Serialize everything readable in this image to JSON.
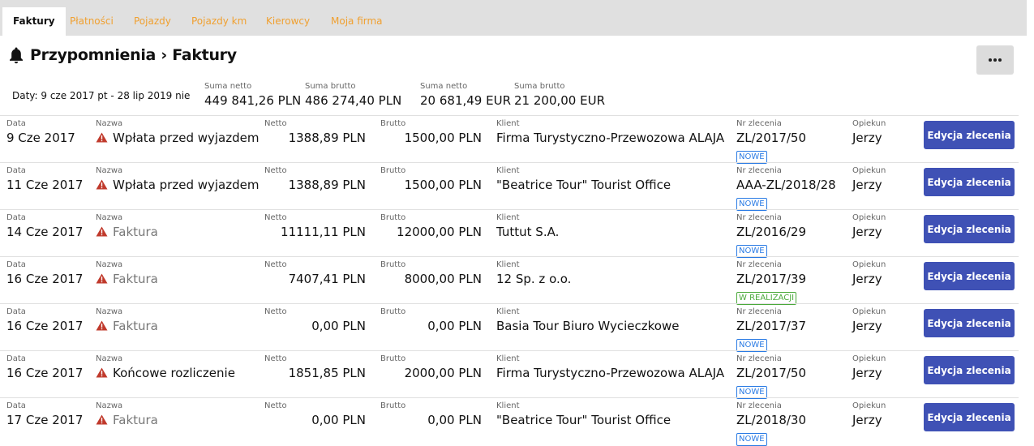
{
  "tabs": [
    "Faktury",
    "Płatności",
    "Pojazdy",
    "Pojazdy km",
    "Kierowcy",
    "Moja firma"
  ],
  "title": "Przypomnienia › Faktury",
  "summary": {
    "dates": "Daty: 9 cze 2017 pt - 28 lip 2019 nie",
    "items": [
      {
        "label": "Suma netto",
        "value": "449 841,26 PLN"
      },
      {
        "label": "Suma brutto",
        "value": "486 274,40 PLN"
      },
      {
        "label": "Suma netto",
        "value": "20 681,49 EUR"
      },
      {
        "label": "Suma brutto",
        "value": "21 200,00 EUR"
      }
    ]
  },
  "labels": {
    "data": "Data",
    "nazwa": "Nazwa",
    "netto": "Netto",
    "brutto": "Brutto",
    "klient": "Klient",
    "nr": "Nr zlecenia",
    "opiekun": "Opiekun"
  },
  "edit_label": "Edycja zlecenia",
  "colors": {
    "accent": "#3f51b5",
    "tab_inactive": "#f0a030",
    "warning": "#c0392b",
    "badge_new": "#2a7be4",
    "badge_in_progress": "#4aa93a"
  },
  "icons": {
    "bell": "bell-icon",
    "warning": "warning-icon",
    "more": "more-icon"
  },
  "rows": [
    {
      "data": "9 Cze 2017",
      "nazwa": "Wpłata przed wyjazdem",
      "muted": false,
      "netto": "1388,89 PLN",
      "brutto": "1500,00 PLN",
      "klient": "Firma Turystyczno-Przewozowa ALAJA",
      "nr": "ZL/2017/50",
      "status": "NOWE",
      "opiekun": "Jerzy"
    },
    {
      "data": "11 Cze 2017",
      "nazwa": "Wpłata przed wyjazdem",
      "muted": false,
      "netto": "1388,89 PLN",
      "brutto": "1500,00 PLN",
      "klient": "\"Beatrice Tour\" Tourist Office",
      "nr": "AAA-ZL/2018/28",
      "status": "NOWE",
      "opiekun": "Jerzy"
    },
    {
      "data": "14 Cze 2017",
      "nazwa": "Faktura",
      "muted": true,
      "netto": "11111,11 PLN",
      "brutto": "12000,00 PLN",
      "klient": "Tuttut S.A.",
      "nr": "ZL/2016/29",
      "status": "NOWE",
      "opiekun": "Jerzy"
    },
    {
      "data": "16 Cze 2017",
      "nazwa": "Faktura",
      "muted": true,
      "netto": "7407,41 PLN",
      "brutto": "8000,00 PLN",
      "klient": "12 Sp. z o.o.",
      "nr": "ZL/2017/39",
      "status": "W REALIZACJI",
      "opiekun": "Jerzy"
    },
    {
      "data": "16 Cze 2017",
      "nazwa": "Faktura",
      "muted": true,
      "netto": "0,00 PLN",
      "brutto": "0,00 PLN",
      "klient": "Basia Tour Biuro Wycieczkowe",
      "nr": "ZL/2017/37",
      "status": "NOWE",
      "opiekun": "Jerzy"
    },
    {
      "data": "16 Cze 2017",
      "nazwa": "Końcowe rozliczenie",
      "muted": false,
      "netto": "1851,85 PLN",
      "brutto": "2000,00 PLN",
      "klient": "Firma Turystyczno-Przewozowa ALAJA",
      "nr": "ZL/2017/50",
      "status": "NOWE",
      "opiekun": "Jerzy"
    },
    {
      "data": "17 Cze 2017",
      "nazwa": "Faktura",
      "muted": true,
      "netto": "0,00 PLN",
      "brutto": "0,00 PLN",
      "klient": "\"Beatrice Tour\" Tourist Office",
      "nr": "ZL/2018/30",
      "status": "NOWE",
      "opiekun": "Jerzy"
    }
  ]
}
